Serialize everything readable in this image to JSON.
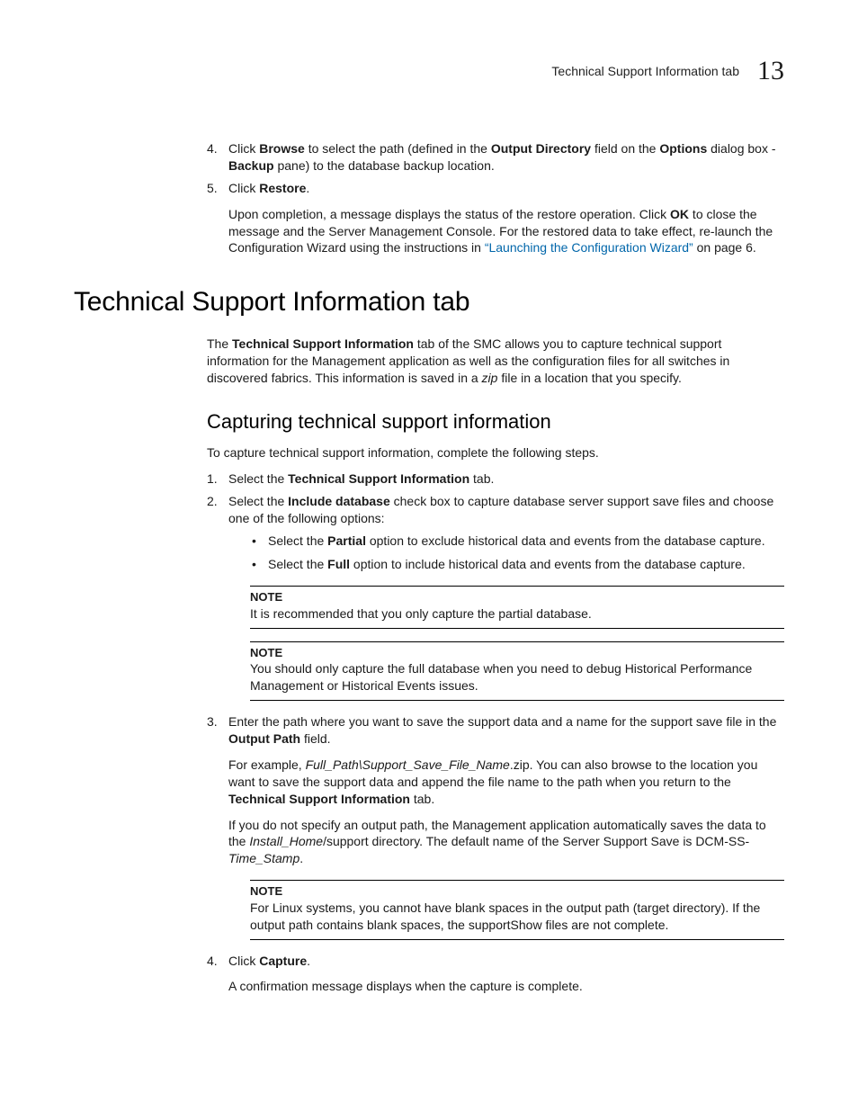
{
  "header": {
    "text": "Technical Support Information tab",
    "chapter_number": "13"
  },
  "top_steps": {
    "s4": {
      "marker": "4.",
      "t1": "Click ",
      "browse": "Browse",
      "t2": " to select the path (defined in the ",
      "output_dir": "Output Directory",
      "t3": " field on the ",
      "options": "Options",
      "t4": " dialog box - ",
      "backup": "Backup",
      "t5": " pane) to the database backup location."
    },
    "s5": {
      "marker": "5.",
      "t1": "Click ",
      "restore": "Restore",
      "t2": ".",
      "p2a": "Upon completion, a message displays the status of the restore operation. Click ",
      "ok": "OK",
      "p2b": " to close the message and the Server Management Console. For the restored data to take effect, re-launch the Configuration Wizard using the instructions in ",
      "xref": "“Launching the Configuration Wizard”",
      "p2c": " on page 6."
    }
  },
  "section": {
    "title": "Technical Support Information tab",
    "intro_a": "The ",
    "intro_b": "Technical Support Information",
    "intro_c": " tab of the SMC allows you to capture technical support information for the Management application as well as the configuration files for all switches in discovered fabrics. This information is saved in a ",
    "intro_zip": "zip",
    "intro_d": " file in a location that you specify."
  },
  "subsection": {
    "title": "Capturing technical support information",
    "lead": "To capture technical support information, complete the following steps.",
    "s1": {
      "marker": "1.",
      "a": "Select the ",
      "b": "Technical Support Information",
      "c": " tab."
    },
    "s2": {
      "marker": "2.",
      "a": "Select the ",
      "b": "Include database",
      "c": " check box to capture database server support save files and choose one of the following options:",
      "bullets": {
        "b1a": "Select the ",
        "b1b": "Partial",
        "b1c": " option to exclude historical data and events from the database capture.",
        "b2a": "Select the ",
        "b2b": "Full",
        "b2c": " option to include historical data and events from the database capture."
      },
      "note1": {
        "label": "NOTE",
        "body": "It is recommended that you only capture the partial database."
      },
      "note2": {
        "label": "NOTE",
        "body": "You should only capture the full database when you need to debug Historical Performance Management or Historical Events issues."
      }
    },
    "s3": {
      "marker": "3.",
      "a": "Enter the path where you want to save the support data and a name for the support save file in the ",
      "b": "Output Path",
      "c": " field.",
      "p2a": "For example, ",
      "p2b": "Full_Path\\Support_Save_File_Name",
      "p2c": ".zip. You can also browse to the location you want to save the support data and append the file name to the path when you return to the ",
      "p2d": "Technical Support Information",
      "p2e": " tab.",
      "p3a": "If you do not specify an output path, the Management application automatically saves the data to the ",
      "p3b": "Install_Home",
      "p3c": "/support directory. The default name of the Server Support Save is DCM-SS-",
      "p3d": "Time_Stamp",
      "p3e": ".",
      "note": {
        "label": "NOTE",
        "body": "For Linux systems, you cannot have blank spaces in the output path (target directory). If the output path contains blank spaces, the supportShow files are not complete."
      }
    },
    "s4": {
      "marker": "4.",
      "a": "Click ",
      "b": "Capture",
      "c": ".",
      "p2": "A confirmation message displays when the capture is complete."
    }
  }
}
